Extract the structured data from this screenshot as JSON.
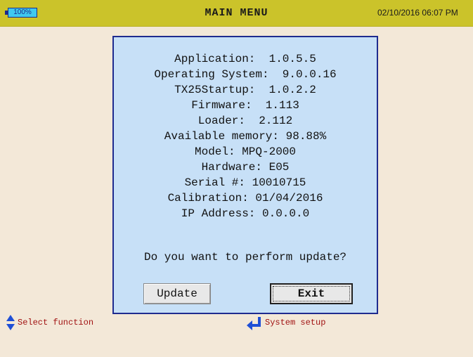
{
  "header": {
    "battery_label": "100%",
    "title": "MAIN MENU",
    "datetime": "02/10/2016 06:07 PM"
  },
  "dialog": {
    "info": [
      "Application:  1.0.5.5",
      "Operating System:  9.0.0.16",
      "TX25Startup:  1.0.2.2",
      "Firmware:  1.113",
      "Loader:  2.112",
      "Available memory: 98.88%",
      "Model: MPQ-2000",
      "Hardware: E05",
      "Serial #: 10010715",
      "Calibration: 01/04/2016",
      "IP Address: 0.0.0.0"
    ],
    "question": "Do you want to perform update?",
    "update_label": "Update",
    "exit_label": "Exit"
  },
  "footer": {
    "left_hint": "Select function",
    "right_hint": "System setup",
    "left_icon": "updown-arrow-icon",
    "right_icon": "enter-icon"
  },
  "colors": {
    "header_bg": "#cbc32a",
    "page_bg": "#f3e8d8",
    "dialog_bg": "#c7e0f7",
    "dialog_border": "#1f2b8f",
    "hint_text": "#a11212",
    "icon_blue": "#1f4fd6"
  }
}
